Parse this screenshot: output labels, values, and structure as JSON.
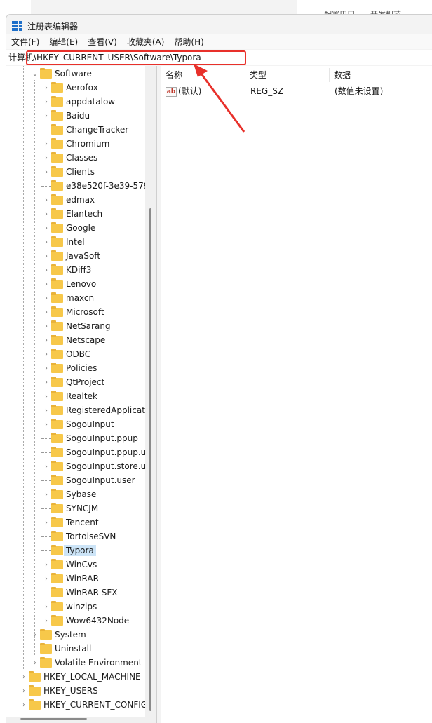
{
  "background_window": {
    "text": "配置用用　　开发规范"
  },
  "title": "注册表编辑器",
  "menu": [
    "文件(F)",
    "编辑(E)",
    "查看(V)",
    "收藏夹(A)",
    "帮助(H)"
  ],
  "address": "计算机\\HKEY_CURRENT_USER\\Software\\Typora",
  "tree": {
    "software": "Software",
    "children": [
      {
        "label": "Aerofox",
        "expandable": true
      },
      {
        "label": "appdatalow",
        "expandable": true
      },
      {
        "label": "Baidu",
        "expandable": true
      },
      {
        "label": "ChangeTracker",
        "expandable": false
      },
      {
        "label": "Chromium",
        "expandable": true
      },
      {
        "label": "Classes",
        "expandable": true
      },
      {
        "label": "Clients",
        "expandable": true
      },
      {
        "label": "e38e520f-3e39-579",
        "expandable": false
      },
      {
        "label": "edmax",
        "expandable": true
      },
      {
        "label": "Elantech",
        "expandable": true
      },
      {
        "label": "Google",
        "expandable": true
      },
      {
        "label": "Intel",
        "expandable": true
      },
      {
        "label": "JavaSoft",
        "expandable": true
      },
      {
        "label": "KDiff3",
        "expandable": true
      },
      {
        "label": "Lenovo",
        "expandable": true
      },
      {
        "label": "maxcn",
        "expandable": true
      },
      {
        "label": "Microsoft",
        "expandable": true
      },
      {
        "label": "NetSarang",
        "expandable": true
      },
      {
        "label": "Netscape",
        "expandable": true
      },
      {
        "label": "ODBC",
        "expandable": true
      },
      {
        "label": "Policies",
        "expandable": true
      },
      {
        "label": "QtProject",
        "expandable": true
      },
      {
        "label": "Realtek",
        "expandable": true
      },
      {
        "label": "RegisteredApplicat",
        "expandable": true
      },
      {
        "label": "SogouInput",
        "expandable": true
      },
      {
        "label": "SogouInput.ppup",
        "expandable": false
      },
      {
        "label": "SogouInput.ppup.u",
        "expandable": false
      },
      {
        "label": "SogouInput.store.u",
        "expandable": true
      },
      {
        "label": "SogouInput.user",
        "expandable": false
      },
      {
        "label": "Sybase",
        "expandable": true
      },
      {
        "label": "SYNCJM",
        "expandable": false
      },
      {
        "label": "Tencent",
        "expandable": true
      },
      {
        "label": "TortoiseSVN",
        "expandable": false
      },
      {
        "label": "Typora",
        "expandable": false,
        "selected": true
      },
      {
        "label": "WinCvs",
        "expandable": true
      },
      {
        "label": "WinRAR",
        "expandable": true
      },
      {
        "label": "WinRAR SFX",
        "expandable": false
      },
      {
        "label": "winzips",
        "expandable": true
      },
      {
        "label": "Wow6432Node",
        "expandable": true
      }
    ],
    "siblings": [
      {
        "label": "System",
        "expandable": true
      },
      {
        "label": "Uninstall",
        "expandable": false
      },
      {
        "label": "Volatile Environment",
        "expandable": true
      }
    ],
    "roots": [
      {
        "label": "HKEY_LOCAL_MACHINE"
      },
      {
        "label": "HKEY_USERS"
      },
      {
        "label": "HKEY_CURRENT_CONFIG"
      }
    ]
  },
  "list": {
    "columns": [
      "名称",
      "类型",
      "数据"
    ],
    "rows": [
      {
        "name": "(默认)",
        "type": "REG_SZ",
        "data": "(数值未设置)",
        "icon": "string-value-icon"
      }
    ]
  },
  "colors": {
    "highlight": "#e8302a",
    "selection": "#cce4f7",
    "folder": "#f7c84a"
  }
}
